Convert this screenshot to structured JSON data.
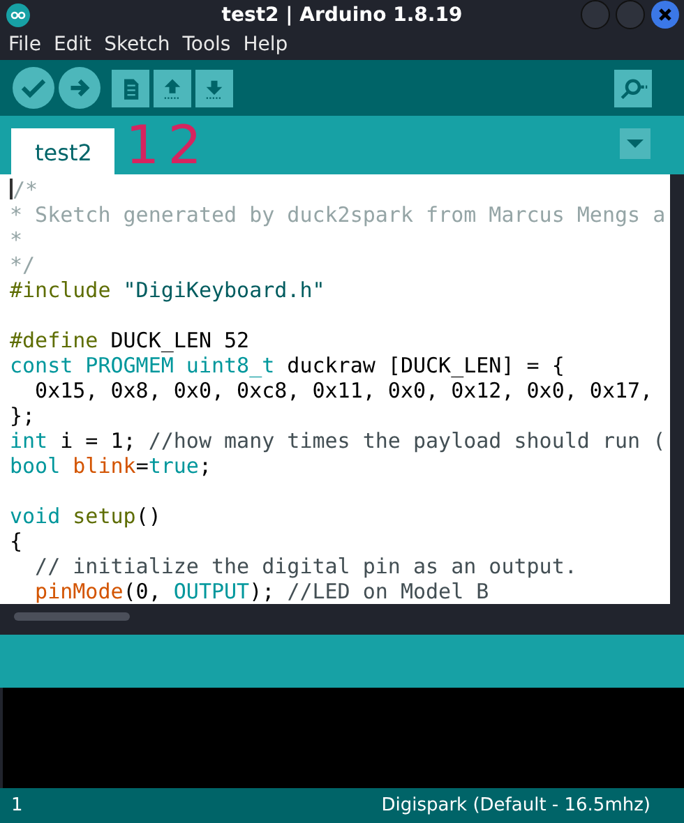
{
  "window": {
    "title": "test2 | Arduino 1.8.19"
  },
  "menu": [
    "File",
    "Edit",
    "Sketch",
    "Tools",
    "Help"
  ],
  "toolbar": [
    {
      "kind": "verify"
    },
    {
      "kind": "upload"
    },
    {
      "kind": "new"
    },
    {
      "kind": "open"
    },
    {
      "kind": "save"
    }
  ],
  "annotations": [
    {
      "text": "1"
    },
    {
      "text": "2"
    }
  ],
  "tabs": [
    {
      "label": "test2",
      "selected": true
    }
  ],
  "editor": {
    "lines": [
      {
        "tokens": [
          {
            "kind": "block-comment",
            "text": "/*"
          }
        ]
      },
      {
        "tokens": [
          {
            "kind": "block-comment",
            "text": "* Sketch generated by duck2spark from Marcus Mengs a"
          }
        ]
      },
      {
        "tokens": [
          {
            "kind": "block-comment",
            "text": "*"
          }
        ]
      },
      {
        "tokens": [
          {
            "kind": "block-comment",
            "text": "*/"
          }
        ]
      },
      {
        "tokens": [
          {
            "kind": "preproc",
            "text": "#include"
          },
          {
            "kind": "string",
            "text": " \"DigiKeyboard.h\""
          }
        ]
      },
      {
        "blank_before": true,
        "tokens": [
          {
            "kind": "preproc",
            "text": "#define"
          },
          {
            "kind": "plain",
            "text": " DUCK_LEN 52"
          }
        ]
      },
      {
        "tokens": [
          {
            "kind": "keyword",
            "text": "const PROGMEM uint8_t"
          },
          {
            "kind": "plain",
            "text": " duckraw [DUCK_LEN] = {"
          }
        ]
      },
      {
        "tokens": [
          {
            "kind": "plain",
            "text": "  0x15, 0x8, 0x0, 0xc8, 0x11, 0x0, 0x12, 0x0, 0x17,"
          }
        ]
      },
      {
        "tokens": [
          {
            "kind": "plain",
            "text": "};"
          }
        ]
      },
      {
        "tokens": [
          {
            "kind": "keyword",
            "text": "int"
          },
          {
            "kind": "plain",
            "text": " i = 1; "
          },
          {
            "kind": "line-comment",
            "text": "//how many times the payload should run ("
          }
        ]
      },
      {
        "tokens": [
          {
            "kind": "keyword",
            "text": "bool"
          },
          {
            "kind": "function",
            "text": " blink"
          },
          {
            "kind": "plain",
            "text": "="
          },
          {
            "kind": "keyword",
            "text": "true"
          },
          {
            "kind": "plain",
            "text": ";"
          }
        ]
      },
      {
        "blank_before": true,
        "tokens": [
          {
            "kind": "keyword",
            "text": "void"
          },
          {
            "kind": "preproc",
            "text": " setup"
          },
          {
            "kind": "plain",
            "text": "()"
          }
        ]
      },
      {
        "tokens": [
          {
            "kind": "plain",
            "text": "{"
          }
        ]
      },
      {
        "tokens": [
          {
            "kind": "line-comment",
            "text": "  // initialize the digital pin as an output."
          }
        ]
      },
      {
        "tokens": [
          {
            "kind": "function",
            "text": "  pinMode"
          },
          {
            "kind": "plain",
            "text": "(0, "
          },
          {
            "kind": "keyword",
            "text": "OUTPUT"
          },
          {
            "kind": "plain",
            "text": "); "
          },
          {
            "kind": "line-comment",
            "text": "//LED on Model B"
          }
        ]
      }
    ]
  },
  "status_bar": {
    "line": "1",
    "board": "Digispark (Default - 16.5mhz)"
  }
}
